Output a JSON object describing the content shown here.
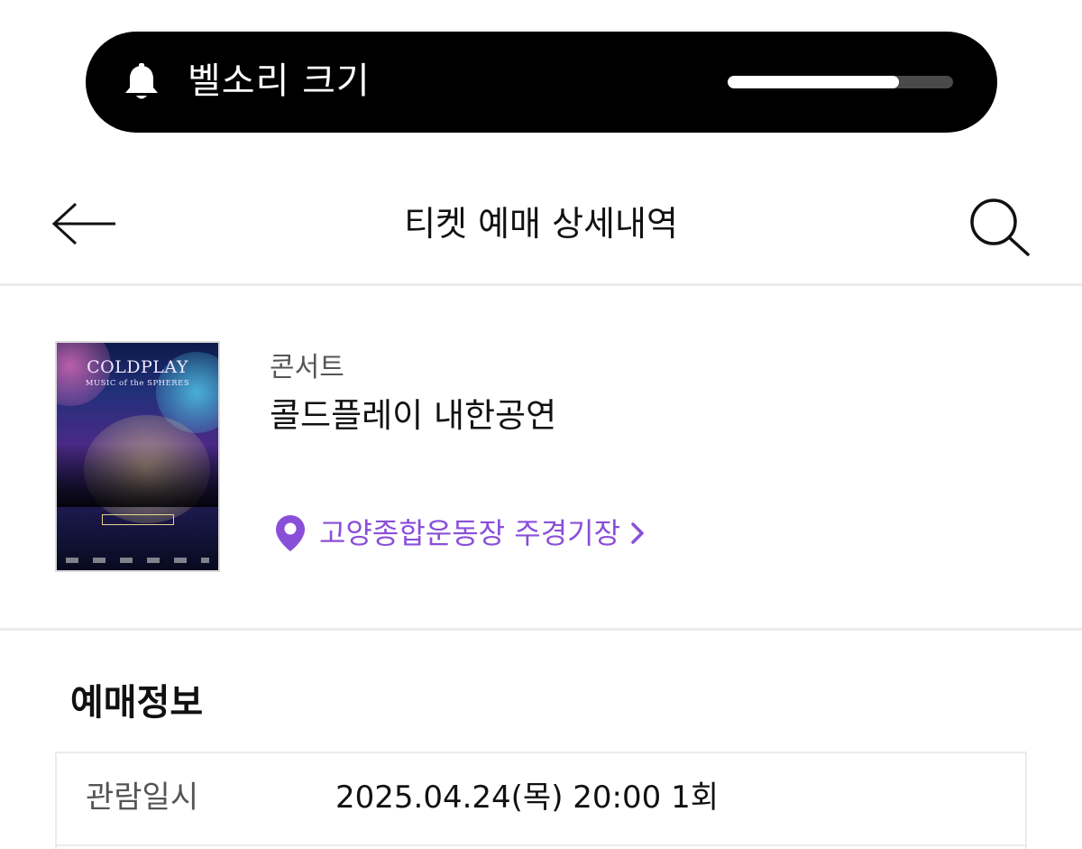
{
  "volume": {
    "label": "벨소리 크기",
    "level_fraction": 0.76,
    "icon": "bell-icon"
  },
  "header": {
    "title": "티켓 예매 상세내역",
    "back_icon": "back-arrow-icon",
    "search_icon": "search-icon"
  },
  "event": {
    "poster": {
      "title": "COLDPLAY",
      "subtitle": "MUSIC of the SPHERES"
    },
    "category": "콘서트",
    "title": "콜드플레이 내한공연",
    "venue": "고양종합운동장 주경기장",
    "venue_icon": "location-pin-icon",
    "accent_color": "#8a4fd8"
  },
  "reservation": {
    "section_title": "예매정보",
    "rows": [
      {
        "label": "관람일시",
        "value": "2025.04.24(목) 20:00 1회"
      }
    ]
  }
}
